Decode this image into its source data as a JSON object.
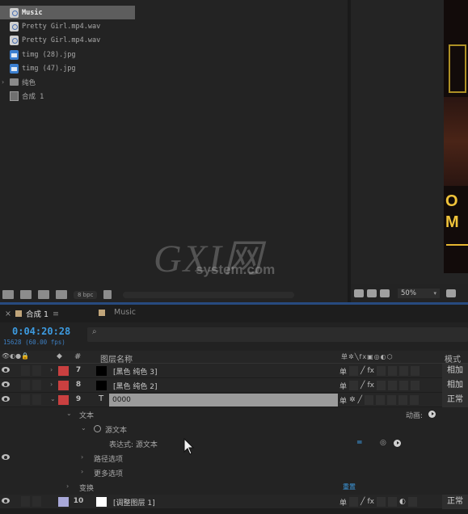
{
  "project": {
    "items": [
      {
        "label": "Music",
        "icon": "audio-file-icon",
        "selected": true
      },
      {
        "label": "Pretty Girl.mp4.wav",
        "icon": "audio-file-icon"
      },
      {
        "label": "Pretty Girl.mp4.wav",
        "icon": "audio-file-icon"
      },
      {
        "label": "timg (28).jpg",
        "icon": "image-file-icon"
      },
      {
        "label": "timg (47).jpg",
        "icon": "image-file-icon"
      },
      {
        "label": "纯色",
        "icon": "folder-icon"
      },
      {
        "label": "合成 1",
        "icon": "composition-icon"
      }
    ],
    "bpc": "8 bpc"
  },
  "viewer": {
    "preview_text_1": "O",
    "preview_text_2": "M",
    "zoom": "50%"
  },
  "watermark": {
    "big": "GXI网",
    "small": "system.com"
  },
  "timeline": {
    "tabs": [
      {
        "label": "合成 1",
        "active": true,
        "color": "#c0a57a"
      },
      {
        "label": "Music",
        "active": false,
        "color": "#c0a57a"
      }
    ],
    "timecode": "0:04:20:28",
    "frames": "15628 (60.00 fps)",
    "search_icon": "⌕",
    "headers": {
      "number": "#",
      "layer_name": "图层名称",
      "mode": "模式"
    },
    "layers": [
      {
        "number": "7",
        "name": "[黑色 纯色 3]",
        "label_color": "#c94040",
        "source_color": "#000000",
        "fx": "fx",
        "mode": "相加",
        "expanded": false
      },
      {
        "number": "8",
        "name": "[黑色 纯色 2]",
        "label_color": "#c94040",
        "source_color": "#000000",
        "fx": "fx",
        "mode": "相加",
        "expanded": false
      },
      {
        "number": "9",
        "name": "0000",
        "type_glyph": "T",
        "label_color": "#c94040",
        "mode": "正常",
        "expanded": true
      },
      {
        "number": "10",
        "name": "[调整图层 1]",
        "label_color": "#a8a8d8",
        "source_color": "#ffffff",
        "fx": "fx",
        "mode": "正常",
        "expanded": false
      }
    ],
    "props": {
      "text_group": "文本",
      "animate_label": "动画:",
      "source_text": "源文本",
      "expression_label": "表达式: 源文本",
      "expression_eq": "=",
      "path_options": "路径选项",
      "more_options": "更多选项",
      "transform": "变换",
      "reset": "重置"
    }
  },
  "colors": {
    "accent_blue": "#3d9be0",
    "label_red": "#c94040"
  }
}
